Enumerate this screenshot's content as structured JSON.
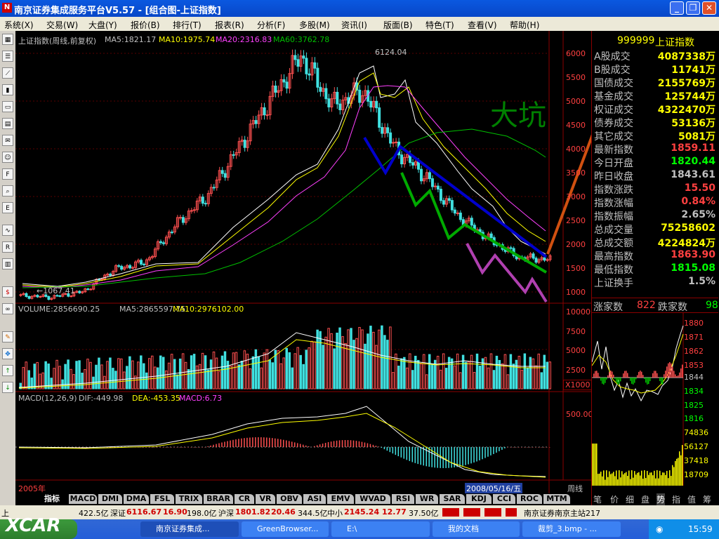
{
  "window": {
    "title": "南京证券集成服务平台V5.57 - [组合图-上证指数]"
  },
  "menu": [
    "系统(X)",
    "交易(W)",
    "大盘(Y)",
    "报价(B)",
    "排行(T)",
    "报表(R)",
    "分析(F)",
    "多股(M)",
    "资讯(I)",
    "版面(B)",
    "特色(T)",
    "查看(V)",
    "帮助(H)"
  ],
  "left_toolbar_icons": [
    "grid-icon",
    "list-icon",
    "line-chart-icon",
    "kline-icon",
    "window-icon",
    "report-icon",
    "news-icon",
    "people-icon",
    "f10-icon",
    "search-icon",
    "etf-icon",
    "wave-icon",
    "rsi-icon",
    "bar-icon",
    "dollar-icon",
    "link-icon",
    "pencil-icon",
    "move-icon",
    "up-arrow-icon",
    "down-arrow-icon"
  ],
  "main": {
    "header": {
      "name": "上证指数(周线,前复权)",
      "ma5": "MA5:1821.17",
      "ma10": "MA10:1975.74",
      "ma20": "MA20:2316.83",
      "ma60": "MA60:3762.78"
    },
    "peak_label": "6124.04",
    "low_label": "←1067.41",
    "annotation": "大坑",
    "price_axis": [
      "6000",
      "5500",
      "5000",
      "4500",
      "4000",
      "3500",
      "3000",
      "2500",
      "2000",
      "1500",
      "1000"
    ],
    "volume_header": {
      "name": "VOLUME:2856690.25",
      "ma5": "MA5:2865597.75",
      "ma10": "MA10:2976102.00"
    },
    "volume_axis": [
      "10000",
      "7500",
      "5000",
      "2500"
    ],
    "volume_unit": "X1000",
    "macd_header": {
      "name": "MACD(12,26,9)",
      "dif": "DIF:-449.98",
      "dea": "DEA:-453.35",
      "macd": "MACD:6.73"
    },
    "macd_axis": [
      "500.00"
    ],
    "date_axis": {
      "year": "2005年",
      "cursor_date": "2008/05/16/五",
      "timeframe": "周线"
    }
  },
  "indicator_tabs": [
    "指标",
    "MACD",
    "DMI",
    "DMA",
    "FSL",
    "TRIX",
    "BRAR",
    "CR",
    "VR",
    "OBV",
    "ASI",
    "EMV",
    "WVAD",
    "RSI",
    "WR",
    "SAR",
    "KDJ",
    "CCI",
    "ROC",
    "MTM"
  ],
  "right_panel": {
    "code": "999999",
    "name": "上证指数",
    "rows": [
      {
        "label": "A股成交",
        "value": "4087338万",
        "color": "#ffff00"
      },
      {
        "label": "B股成交",
        "value": "11741万",
        "color": "#ffff00"
      },
      {
        "label": "国债成交",
        "value": "2155769万",
        "color": "#ffff00"
      },
      {
        "label": "基金成交",
        "value": "125744万",
        "color": "#ffff00"
      },
      {
        "label": "权证成交",
        "value": "4322470万",
        "color": "#ffff00"
      },
      {
        "label": "债券成交",
        "value": "53136万",
        "color": "#ffff00"
      },
      {
        "label": "其它成交",
        "value": "5081万",
        "color": "#ffff00"
      },
      {
        "label": "最新指数",
        "value": "1859.11",
        "color": "#ff4040"
      },
      {
        "label": "今日开盘",
        "value": "1820.44",
        "color": "#00ff00"
      },
      {
        "label": "昨日收盘",
        "value": "1843.61",
        "color": "#c0c0c0"
      },
      {
        "label": "指数涨跌",
        "value": "15.50",
        "color": "#ff4040"
      },
      {
        "label": "指数涨幅",
        "value": "0.84%",
        "color": "#ff4040"
      },
      {
        "label": "指数振幅",
        "value": "2.65%",
        "color": "#c0c0c0"
      },
      {
        "label": "总成交量",
        "value": "75258602",
        "color": "#ffff00"
      },
      {
        "label": "总成交额",
        "value": "4224824万",
        "color": "#ffff00"
      },
      {
        "label": "最高指数",
        "value": "1863.90",
        "color": "#ff4040"
      },
      {
        "label": "最低指数",
        "value": "1815.08",
        "color": "#00ff00"
      },
      {
        "label": "上证换手",
        "value": "1.5%",
        "color": "#c0c0c0"
      }
    ],
    "breadth": {
      "up_label": "涨家数",
      "up": "822",
      "down_label": "跌家数",
      "down": "98"
    },
    "intraday_price_axis": [
      "1880",
      "1871",
      "1862",
      "1853",
      "1844",
      "1834",
      "1825",
      "1816"
    ],
    "intraday_volume_axis": [
      "74836",
      "56127",
      "37418",
      "18709"
    ],
    "tabs": [
      "笔",
      "价",
      "细",
      "盘",
      "势",
      "指",
      "值",
      "筹"
    ]
  },
  "status": {
    "pre": "上",
    "amount1": "422.5亿",
    "sz_label": "深证",
    "sz_value": "6116.67",
    "sz_chg": "16.90",
    "sz_amt": "198.0亿",
    "hs_label": "沪深",
    "hs_value": "1801.82",
    "hs_chg": "20.46",
    "hs_amt": "344.5亿",
    "zx_label": "中小",
    "zx_value": "2145.24",
    "zx_chg": "12.77",
    "zx_amt": "37.50亿",
    "station": "南京证券南京主站217"
  },
  "taskbar": {
    "tasks": [
      "南京证券集成...",
      "GreenBrowser...",
      "E:\\",
      "我的文档",
      "裁剪_3.bmp - ..."
    ],
    "clock": "15:59",
    "watermark": "XCAR"
  },
  "chart_data": {
    "type": "line",
    "title": "上证指数(周线,前复权)",
    "ylim": [
      1000,
      6300
    ],
    "points": [
      {
        "x": "2005",
        "y": 1100
      },
      {
        "x": "2005-06",
        "y": 1067.41
      },
      {
        "x": "2006-01",
        "y": 1180
      },
      {
        "x": "2006-06",
        "y": 1650
      },
      {
        "x": "2006-09",
        "y": 1800
      },
      {
        "x": "2006-12",
        "y": 2600
      },
      {
        "x": "2007-03",
        "y": 3200
      },
      {
        "x": "2007-06",
        "y": 4200
      },
      {
        "x": "2007-08",
        "y": 5200
      },
      {
        "x": "2007-10",
        "y": 6124.04
      },
      {
        "x": "2007-12",
        "y": 5100
      },
      {
        "x": "2008-01",
        "y": 5400
      },
      {
        "x": "2008-03",
        "y": 4200
      },
      {
        "x": "2008-05",
        "y": 3600
      },
      {
        "x": "2008-07",
        "y": 2800
      },
      {
        "x": "2008-09",
        "y": 2300
      },
      {
        "x": "2008-10",
        "y": 1900
      },
      {
        "x": "2008-11",
        "y": 1859.11
      }
    ]
  }
}
